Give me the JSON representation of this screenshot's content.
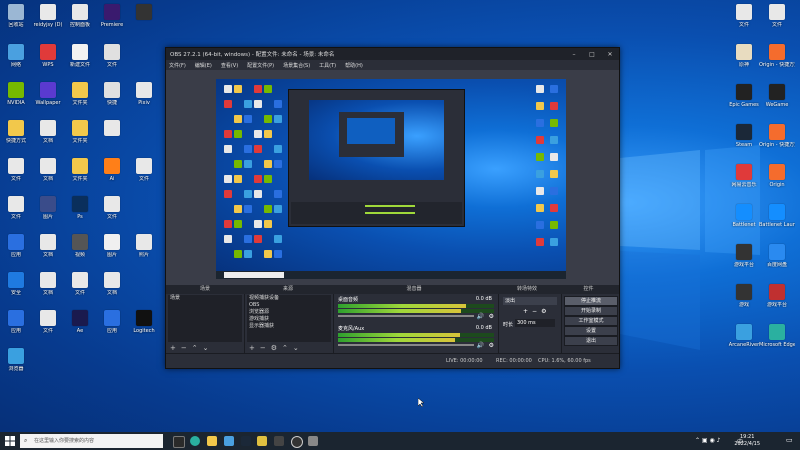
{
  "desktop": {
    "left_icons": [
      {
        "label": "回收站",
        "color": "#9bb7d4"
      },
      {
        "label": "reidyjsy (D)",
        "color": "#e9e9e9"
      },
      {
        "label": "控制面板",
        "color": "#e8e8e8"
      },
      {
        "label": "Premiere",
        "color": "#3a1a6e"
      },
      {
        "label": "",
        "color": "#333"
      },
      {
        "label": "网络",
        "color": "#4aa0e0"
      },
      {
        "label": "WPS",
        "color": "#e03a3a"
      },
      {
        "label": "新建文件",
        "color": "#f2f2f2"
      },
      {
        "label": "文件",
        "color": "#e0e0e0"
      },
      {
        "label": "NVIDIA",
        "color": "#76b900"
      },
      {
        "label": "Wallpaper",
        "color": "#5a3ad0"
      },
      {
        "label": "文件夹",
        "color": "#f2c84b"
      },
      {
        "label": "快捷",
        "color": "#e0e0e0"
      },
      {
        "label": "Pixiv",
        "color": "#e8e8e8"
      },
      {
        "label": "快捷方式",
        "color": "#f2c84b"
      },
      {
        "label": "文档",
        "color": "#e8e8e8"
      },
      {
        "label": "文件夹",
        "color": "#f2c84b"
      },
      {
        "label": "",
        "color": "#e8e8e8"
      },
      {
        "label": "文件",
        "color": "#e8e8e8"
      },
      {
        "label": "文档",
        "color": "#e8e8e8"
      },
      {
        "label": "文件夹",
        "color": "#f2c84b"
      },
      {
        "label": "Ai",
        "color": "#ff7f18"
      },
      {
        "label": "文件",
        "color": "#e8e8e8"
      },
      {
        "label": "文件",
        "color": "#e8e8e8"
      },
      {
        "label": "图片",
        "color": "#3a4c8a"
      },
      {
        "label": "Ps",
        "color": "#0a2f5c"
      },
      {
        "label": "文件",
        "color": "#e8e8e8"
      },
      {
        "label": "应用",
        "color": "#2a6fe0"
      },
      {
        "label": "文档",
        "color": "#e8e8e8"
      },
      {
        "label": "视频",
        "color": "#555"
      },
      {
        "label": "图片",
        "color": "#f0f0f0"
      },
      {
        "label": "照片",
        "color": "#e8e8e8"
      },
      {
        "label": "安全",
        "color": "#1f7ae0"
      },
      {
        "label": "文档",
        "color": "#e8e8e8"
      },
      {
        "label": "文件",
        "color": "#e8e8e8"
      },
      {
        "label": "文档",
        "color": "#e8e8e8"
      },
      {
        "label": "应用",
        "color": "#2a6fe0"
      },
      {
        "label": "文件",
        "color": "#e8e8e8"
      },
      {
        "label": "Ae",
        "color": "#1a1a4e"
      },
      {
        "label": "应用",
        "color": "#2a6fe0"
      },
      {
        "label": "Logitech",
        "color": "#111"
      },
      {
        "label": "浏览器",
        "color": "#3aa0e0"
      }
    ],
    "right_icons": [
      {
        "label": "文件",
        "color": "#e8e8e8"
      },
      {
        "label": "文件",
        "color": "#e8e8e8"
      },
      {
        "label": "原神",
        "color": "#e8dcc0"
      },
      {
        "label": "Origin - 快捷方式",
        "color": "#f56c2d"
      },
      {
        "label": "Epic Games",
        "color": "#222"
      },
      {
        "label": "WeGame",
        "color": "#222"
      },
      {
        "label": "Steam",
        "color": "#1b2838"
      },
      {
        "label": "Origin - 快捷方式",
        "color": "#f56c2d"
      },
      {
        "label": "网易云音乐",
        "color": "#e03a3a"
      },
      {
        "label": "Origin",
        "color": "#f56c2d"
      },
      {
        "label": "Battlenet",
        "color": "#148eff"
      },
      {
        "label": "Battlenet Launcher",
        "color": "#148eff"
      },
      {
        "label": "游戏平台",
        "color": "#333"
      },
      {
        "label": "百度网盘",
        "color": "#2a8af0"
      },
      {
        "label": "游戏",
        "color": "#333"
      },
      {
        "label": "游戏平台",
        "color": "#c03030"
      },
      {
        "label": "ArcaneRiver",
        "color": "#3aa0e0"
      },
      {
        "label": "Microsoft Edge",
        "color": "#2ab0a0"
      }
    ]
  },
  "obs": {
    "title": "OBS 27.2.1 (64-bit, windows) - 配置文件: 未命名 - 场景: 未命名",
    "menu": [
      "文件(F)",
      "编辑(E)",
      "查看(V)",
      "配置文件(P)",
      "场景集合(S)",
      "工具(T)",
      "帮助(H)"
    ],
    "docks": {
      "scenes": {
        "header": "场景",
        "items": [
          "场景"
        ]
      },
      "sources": {
        "header": "来源",
        "items": [
          "视频捕获设备",
          "OBS",
          "浏览器源",
          "游戏捕获",
          "显示器捕获"
        ]
      },
      "mixer": {
        "header": "混音器",
        "tracks": [
          {
            "name": "桌面音频",
            "level": 0.82,
            "db": "0.0 dB"
          },
          {
            "name": "麦克风/Aux",
            "level": 0.78,
            "db": "0.0 dB"
          }
        ]
      },
      "transitions": {
        "header": "转场特效",
        "mode": "淡出",
        "duration_label": "时长",
        "duration": "300 ms"
      },
      "controls": {
        "header": "控件",
        "buttons": [
          "停止推流",
          "开始录制",
          "工作室模式",
          "设置",
          "退出"
        ]
      }
    },
    "status": {
      "live": "LIVE: 00:00:00",
      "rec": "REC: 00:00:00",
      "cpu": "CPU: 1.6%, 60.00 fps"
    }
  },
  "taskbar": {
    "search_placeholder": "在这里输入你要搜索的内容",
    "time": "19:21",
    "date": "2022/4/15",
    "lang": "中"
  }
}
